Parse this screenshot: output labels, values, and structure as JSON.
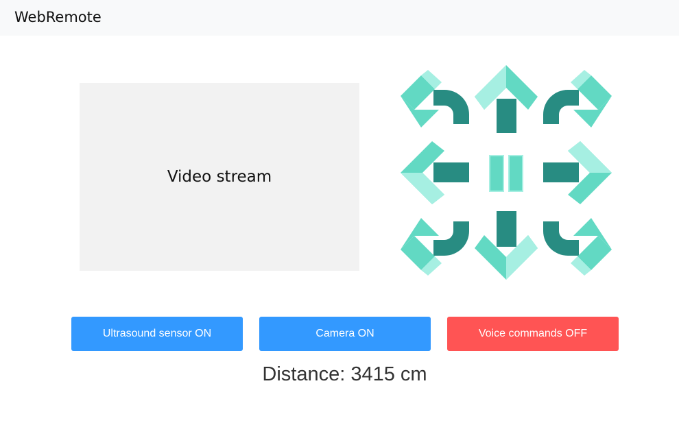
{
  "navbar": {
    "brand": "WebRemote"
  },
  "video": {
    "label": "Video stream"
  },
  "controls": {
    "colors": {
      "light": "#a6efe2",
      "mid": "#62d9c3",
      "dark": "#288c82",
      "shadow": "#1a6e66"
    },
    "directions": [
      "forward-left",
      "forward",
      "forward-right",
      "left",
      "stop",
      "right",
      "backward-left",
      "backward",
      "backward-right"
    ]
  },
  "buttons": {
    "ultrasound": "Ultrasound sensor ON",
    "camera": "Camera ON",
    "voice": "Voice commands OFF",
    "colors": {
      "on": "#3399ff",
      "off": "#ff5454"
    }
  },
  "distance": {
    "text": "Distance: 3415 cm"
  }
}
